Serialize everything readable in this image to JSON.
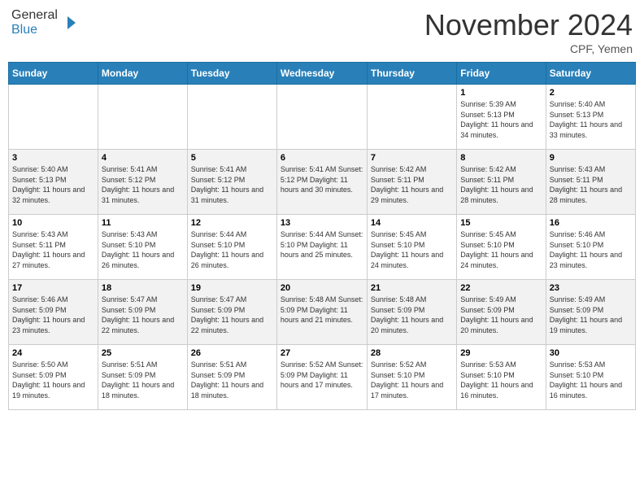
{
  "header": {
    "logo_line1": "General",
    "logo_line2": "Blue",
    "month": "November 2024",
    "location": "CPF, Yemen"
  },
  "days_of_week": [
    "Sunday",
    "Monday",
    "Tuesday",
    "Wednesday",
    "Thursday",
    "Friday",
    "Saturday"
  ],
  "weeks": [
    [
      {
        "day": "",
        "info": ""
      },
      {
        "day": "",
        "info": ""
      },
      {
        "day": "",
        "info": ""
      },
      {
        "day": "",
        "info": ""
      },
      {
        "day": "",
        "info": ""
      },
      {
        "day": "1",
        "info": "Sunrise: 5:39 AM\nSunset: 5:13 PM\nDaylight: 11 hours\nand 34 minutes."
      },
      {
        "day": "2",
        "info": "Sunrise: 5:40 AM\nSunset: 5:13 PM\nDaylight: 11 hours\nand 33 minutes."
      }
    ],
    [
      {
        "day": "3",
        "info": "Sunrise: 5:40 AM\nSunset: 5:13 PM\nDaylight: 11 hours\nand 32 minutes."
      },
      {
        "day": "4",
        "info": "Sunrise: 5:41 AM\nSunset: 5:12 PM\nDaylight: 11 hours\nand 31 minutes."
      },
      {
        "day": "5",
        "info": "Sunrise: 5:41 AM\nSunset: 5:12 PM\nDaylight: 11 hours\nand 31 minutes."
      },
      {
        "day": "6",
        "info": "Sunrise: 5:41 AM\nSunset: 5:12 PM\nDaylight: 11 hours\nand 30 minutes."
      },
      {
        "day": "7",
        "info": "Sunrise: 5:42 AM\nSunset: 5:11 PM\nDaylight: 11 hours\nand 29 minutes."
      },
      {
        "day": "8",
        "info": "Sunrise: 5:42 AM\nSunset: 5:11 PM\nDaylight: 11 hours\nand 28 minutes."
      },
      {
        "day": "9",
        "info": "Sunrise: 5:43 AM\nSunset: 5:11 PM\nDaylight: 11 hours\nand 28 minutes."
      }
    ],
    [
      {
        "day": "10",
        "info": "Sunrise: 5:43 AM\nSunset: 5:11 PM\nDaylight: 11 hours\nand 27 minutes."
      },
      {
        "day": "11",
        "info": "Sunrise: 5:43 AM\nSunset: 5:10 PM\nDaylight: 11 hours\nand 26 minutes."
      },
      {
        "day": "12",
        "info": "Sunrise: 5:44 AM\nSunset: 5:10 PM\nDaylight: 11 hours\nand 26 minutes."
      },
      {
        "day": "13",
        "info": "Sunrise: 5:44 AM\nSunset: 5:10 PM\nDaylight: 11 hours\nand 25 minutes."
      },
      {
        "day": "14",
        "info": "Sunrise: 5:45 AM\nSunset: 5:10 PM\nDaylight: 11 hours\nand 24 minutes."
      },
      {
        "day": "15",
        "info": "Sunrise: 5:45 AM\nSunset: 5:10 PM\nDaylight: 11 hours\nand 24 minutes."
      },
      {
        "day": "16",
        "info": "Sunrise: 5:46 AM\nSunset: 5:10 PM\nDaylight: 11 hours\nand 23 minutes."
      }
    ],
    [
      {
        "day": "17",
        "info": "Sunrise: 5:46 AM\nSunset: 5:09 PM\nDaylight: 11 hours\nand 23 minutes."
      },
      {
        "day": "18",
        "info": "Sunrise: 5:47 AM\nSunset: 5:09 PM\nDaylight: 11 hours\nand 22 minutes."
      },
      {
        "day": "19",
        "info": "Sunrise: 5:47 AM\nSunset: 5:09 PM\nDaylight: 11 hours\nand 22 minutes."
      },
      {
        "day": "20",
        "info": "Sunrise: 5:48 AM\nSunset: 5:09 PM\nDaylight: 11 hours\nand 21 minutes."
      },
      {
        "day": "21",
        "info": "Sunrise: 5:48 AM\nSunset: 5:09 PM\nDaylight: 11 hours\nand 20 minutes."
      },
      {
        "day": "22",
        "info": "Sunrise: 5:49 AM\nSunset: 5:09 PM\nDaylight: 11 hours\nand 20 minutes."
      },
      {
        "day": "23",
        "info": "Sunrise: 5:49 AM\nSunset: 5:09 PM\nDaylight: 11 hours\nand 19 minutes."
      }
    ],
    [
      {
        "day": "24",
        "info": "Sunrise: 5:50 AM\nSunset: 5:09 PM\nDaylight: 11 hours\nand 19 minutes."
      },
      {
        "day": "25",
        "info": "Sunrise: 5:51 AM\nSunset: 5:09 PM\nDaylight: 11 hours\nand 18 minutes."
      },
      {
        "day": "26",
        "info": "Sunrise: 5:51 AM\nSunset: 5:09 PM\nDaylight: 11 hours\nand 18 minutes."
      },
      {
        "day": "27",
        "info": "Sunrise: 5:52 AM\nSunset: 5:09 PM\nDaylight: 11 hours\nand 17 minutes."
      },
      {
        "day": "28",
        "info": "Sunrise: 5:52 AM\nSunset: 5:10 PM\nDaylight: 11 hours\nand 17 minutes."
      },
      {
        "day": "29",
        "info": "Sunrise: 5:53 AM\nSunset: 5:10 PM\nDaylight: 11 hours\nand 16 minutes."
      },
      {
        "day": "30",
        "info": "Sunrise: 5:53 AM\nSunset: 5:10 PM\nDaylight: 11 hours\nand 16 minutes."
      }
    ]
  ]
}
